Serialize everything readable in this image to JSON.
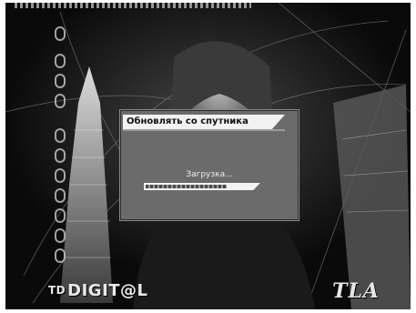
{
  "osd": {
    "title": "Обновлять со спутника",
    "status": "Загрузка...",
    "progress": 0.72
  },
  "logos": {
    "left_prefix": "TD",
    "left": "DIGIT@L",
    "right": "TLA"
  },
  "icons": {
    "glyph_strip": "vertical-text-glyphs"
  },
  "colors": {
    "dialog_bg": "#6b6b6b",
    "title_bg": "#f2f2f2",
    "progress_bg": "#f4f4f4"
  }
}
